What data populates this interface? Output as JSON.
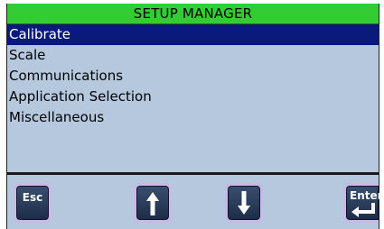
{
  "header": {
    "title": "SETUP MANAGER"
  },
  "menu": {
    "selected_index": 0,
    "items": [
      {
        "label": "Calibrate"
      },
      {
        "label": "Scale"
      },
      {
        "label": "Communications"
      },
      {
        "label": "Application Selection"
      },
      {
        "label": "Miscellaneous"
      }
    ]
  },
  "softkeys": {
    "esc_label": "Esc",
    "up_icon": "arrow-up-icon",
    "down_icon": "arrow-down-icon",
    "enter_label": "Enter",
    "enter_icon": "return-arrow-icon"
  },
  "colors": {
    "title_bar": "#33cc33",
    "screen_background": "#b5c8de",
    "selected_row": "#0a1a7a",
    "key_face": "#1b2c47",
    "key_border": "#c9b8e8"
  }
}
